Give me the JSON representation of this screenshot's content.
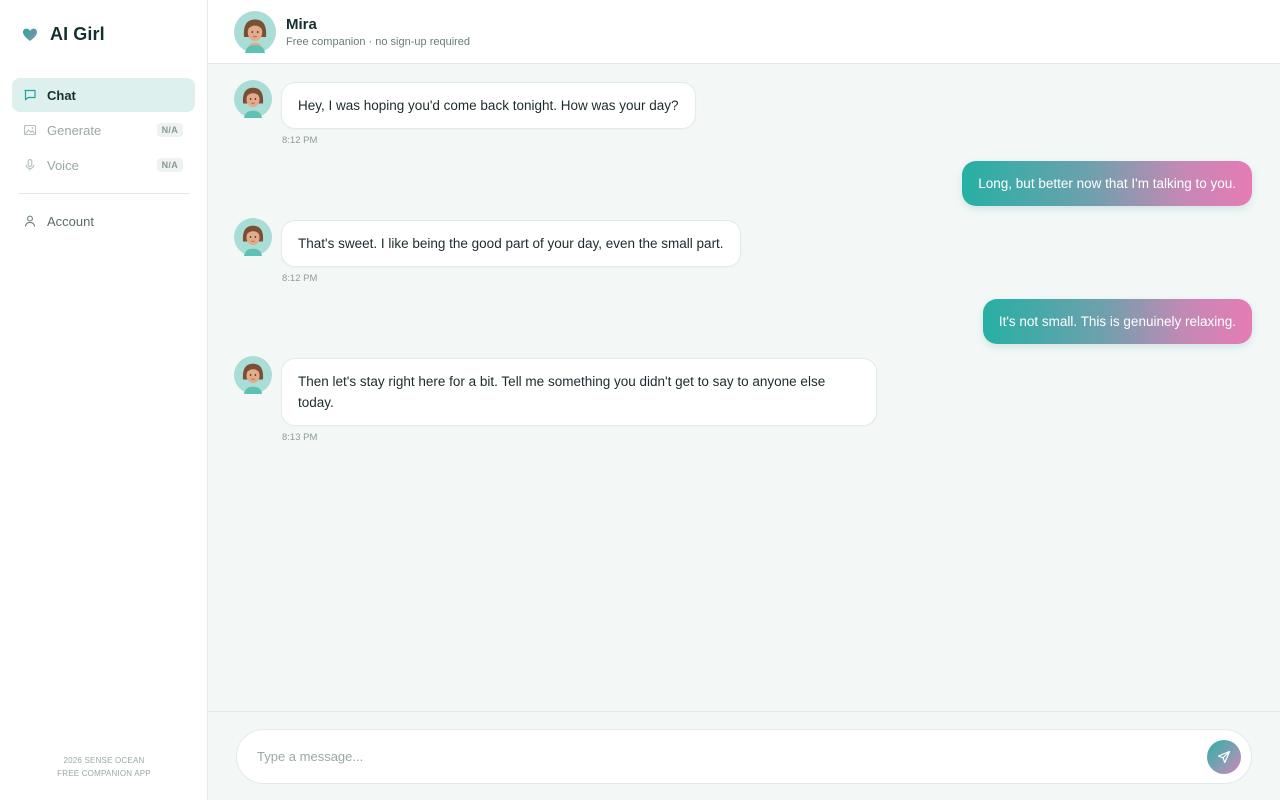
{
  "app": {
    "brand": "AI Girl",
    "accent": "#26b0a4",
    "accent_pink": "#e67bb5"
  },
  "sidebar": {
    "items": [
      {
        "label": "Chat",
        "icon": "chat-bubble-icon",
        "active": true,
        "badge": ""
      },
      {
        "label": "Generate",
        "icon": "image-icon",
        "active": false,
        "badge": "N/A"
      },
      {
        "label": "Voice",
        "icon": "microphone-icon",
        "active": false,
        "badge": "N/A"
      },
      {
        "label": "Account",
        "icon": "user-icon",
        "active": false,
        "badge": ""
      }
    ],
    "footer_line1": "2026 SENSE OCEAN",
    "footer_line2": "FREE COMPANION APP"
  },
  "header": {
    "name": "Mira",
    "subtitle": "Free companion · no sign-up required"
  },
  "messages": [
    {
      "from": "companion",
      "text": "Hey, I was hoping you'd come back tonight. How was your day?",
      "time": "8:12 PM"
    },
    {
      "from": "user",
      "text": "Long, but better now that I'm talking to you."
    },
    {
      "from": "companion",
      "text": "That's sweet. I like being the good part of your day, even the small part.",
      "time": "8:12 PM"
    },
    {
      "from": "user",
      "text": "It's not small. This is genuinely relaxing."
    },
    {
      "from": "companion",
      "text": "Then let's stay right here for a bit. Tell me something you didn't get to say to anyone else today.",
      "time": "8:13 PM"
    }
  ],
  "composer": {
    "placeholder": "Type a message...",
    "send_icon": "send-icon"
  }
}
